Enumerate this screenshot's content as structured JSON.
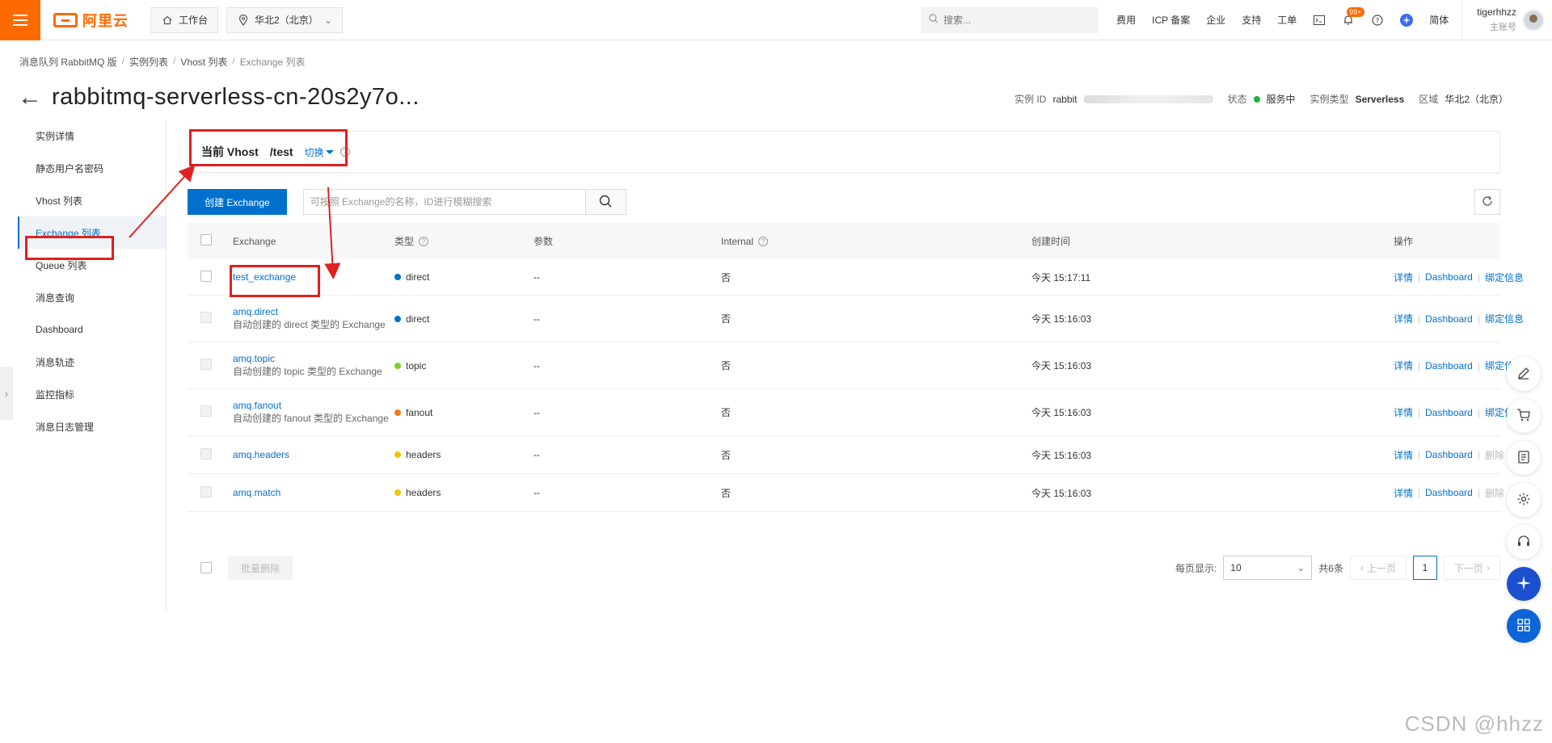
{
  "topbar": {
    "brand": "阿里云",
    "workbench": "工作台",
    "region": "华北2（北京）",
    "search_placeholder": "搜索...",
    "links": [
      "费用",
      "ICP 备案",
      "企业",
      "支持",
      "工单"
    ],
    "notify_badge": "99+",
    "lang": "简体",
    "user_name": "tigerhhzz",
    "user_sub": "主账号"
  },
  "breadcrumb": [
    "消息队列 RabbitMQ 版",
    "实例列表",
    "Vhost 列表",
    "Exchange 列表"
  ],
  "header": {
    "title": "rabbitmq-serverless-cn-20s2y7o...",
    "instance_id_label": "实例 ID",
    "instance_id_prefix": "rabbit",
    "status_label": "状态",
    "status_value": "服务中",
    "type_label": "实例类型",
    "type_value": "Serverless",
    "region_label": "区域",
    "region_value": "华北2（北京）"
  },
  "sidebar": {
    "items": [
      {
        "label": "实例详情"
      },
      {
        "label": "静态用户名密码"
      },
      {
        "label": "Vhost 列表"
      },
      {
        "label": "Exchange 列表"
      },
      {
        "label": "Queue 列表"
      },
      {
        "label": "消息查询"
      },
      {
        "label": "Dashboard"
      },
      {
        "label": "消息轨迹"
      },
      {
        "label": "监控指标"
      },
      {
        "label": "消息日志管理"
      }
    ]
  },
  "vhost": {
    "label": "当前 Vhost",
    "value": "/test",
    "switch_label": "切换"
  },
  "toolbar": {
    "create_label": "创建 Exchange",
    "search_placeholder": "可按照 Exchange的名称，ID进行模糊搜索"
  },
  "table": {
    "headers": {
      "exchange": "Exchange",
      "type": "类型",
      "args": "参数",
      "internal": "Internal",
      "created": "创建时间",
      "ops": "操作"
    },
    "rows": [
      {
        "name": "test_exchange",
        "desc": "",
        "type": "direct",
        "type_color": "#0070cc",
        "args": "--",
        "internal": "否",
        "created": "今天 15:17:11",
        "op1": "详情",
        "op2": "Dashboard",
        "op3": "绑定信息",
        "op3_enabled": true
      },
      {
        "name": "amq.direct",
        "desc": "自动创建的 direct 类型的 Exchange",
        "type": "direct",
        "type_color": "#0070cc",
        "args": "--",
        "internal": "否",
        "created": "今天 15:16:03",
        "op1": "详情",
        "op2": "Dashboard",
        "op3": "绑定信息",
        "op3_enabled": true
      },
      {
        "name": "amq.topic",
        "desc": "自动创建的 topic 类型的 Exchange",
        "type": "topic",
        "type_color": "#7ed321",
        "args": "--",
        "internal": "否",
        "created": "今天 15:16:03",
        "op1": "详情",
        "op2": "Dashboard",
        "op3": "绑定信息",
        "op3_enabled": true
      },
      {
        "name": "amq.fanout",
        "desc": "自动创建的 fanout 类型的 Exchange",
        "type": "fanout",
        "type_color": "#f5761d",
        "args": "--",
        "internal": "否",
        "created": "今天 15:16:03",
        "op1": "详情",
        "op2": "Dashboard",
        "op3": "绑定信息",
        "op3_enabled": true
      },
      {
        "name": "amq.headers",
        "desc": "",
        "type": "headers",
        "type_color": "#f5c400",
        "args": "--",
        "internal": "否",
        "created": "今天 15:16:03",
        "op1": "详情",
        "op2": "Dashboard",
        "op3": "删除",
        "op3_enabled": false
      },
      {
        "name": "amq.match",
        "desc": "",
        "type": "headers",
        "type_color": "#f5c400",
        "args": "--",
        "internal": "否",
        "created": "今天 15:16:03",
        "op1": "详情",
        "op2": "Dashboard",
        "op3": "删除",
        "op3_enabled": false
      }
    ]
  },
  "footer": {
    "batch_delete": "批量删除",
    "page_size_label": "每页显示:",
    "page_size": "10",
    "total": "共6条",
    "prev": "上一页",
    "page": "1",
    "next": "下一页"
  },
  "watermark": "CSDN @hhzz"
}
